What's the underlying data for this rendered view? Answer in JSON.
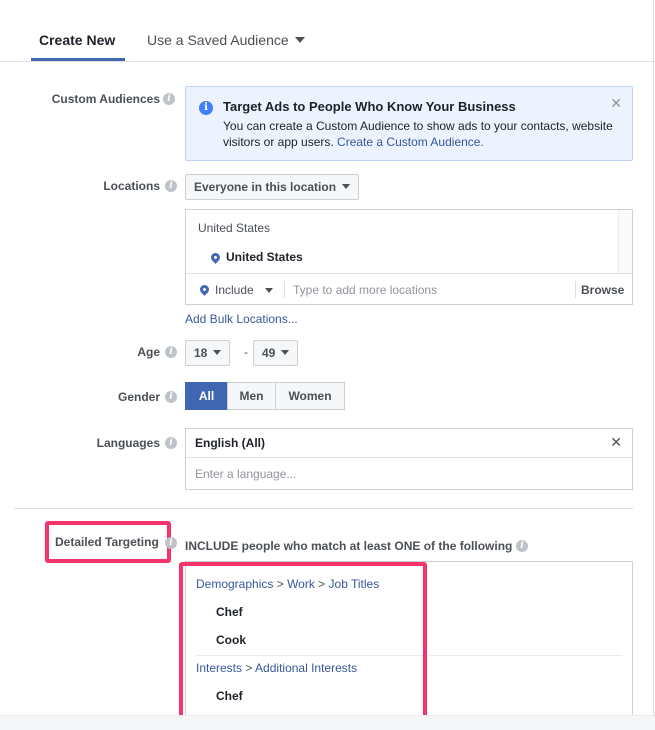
{
  "tabs": {
    "create_new": "Create New",
    "saved_audience": "Use a Saved Audience"
  },
  "custom_audiences": {
    "label": "Custom Audiences",
    "banner_title": "Target Ads to People Who Know Your Business",
    "banner_body": "You can create a Custom Audience to show ads to your contacts, website visitors or app users. ",
    "banner_link": "Create a Custom Audience."
  },
  "locations": {
    "label": "Locations",
    "scope": "Everyone in this location",
    "country_heading": "United States",
    "country": "United States",
    "include": "Include",
    "placeholder": "Type to add more locations",
    "browse": "Browse",
    "bulk_link": "Add Bulk Locations..."
  },
  "age": {
    "label": "Age",
    "min": "18",
    "dash": "-",
    "max": "49"
  },
  "gender": {
    "label": "Gender",
    "all": "All",
    "men": "Men",
    "women": "Women"
  },
  "languages": {
    "label": "Languages",
    "selected": "English (All)",
    "placeholder": "Enter a language..."
  },
  "detailed_targeting": {
    "label": "Detailed Targeting",
    "heading": "INCLUDE people who match at least ONE of the following",
    "group1": {
      "c1": "Demographics",
      "c2": "Work",
      "c3": "Job Titles",
      "items": [
        "Chef",
        "Cook"
      ]
    },
    "group2": {
      "c1": "Interests",
      "c2": "Additional Interests",
      "items": [
        "Chef"
      ]
    }
  },
  "colors": {
    "accent": "#4267b2",
    "highlight": "#f6336b",
    "link": "#365899"
  }
}
